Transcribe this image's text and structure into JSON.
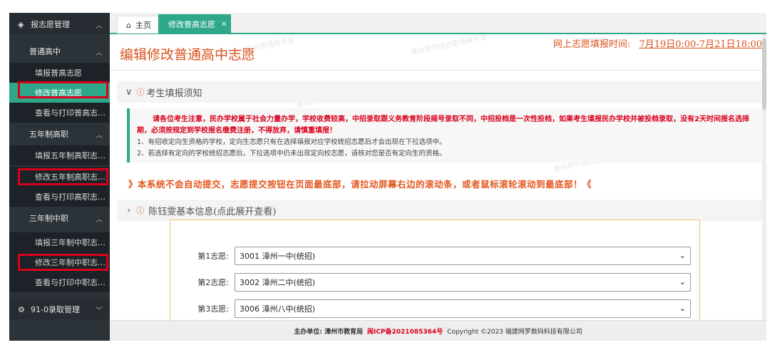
{
  "sidebar": {
    "top_menu": {
      "label": "报志愿管理",
      "icon": "layers-icon"
    },
    "groups": [
      {
        "label": "普通高中",
        "items": [
          "填报普高志愿",
          "修改普高志愿",
          "查看与打印普高志…"
        ]
      },
      {
        "label": "五年制高职",
        "items": [
          "填报五年制高职志…",
          "修改五年制高职志…",
          "查看与打印高职志…"
        ]
      },
      {
        "label": "三年制中职",
        "items": [
          "填报三年制中职志…",
          "修改三年制中职志…",
          "查看与打印中职志…"
        ]
      }
    ],
    "bottom_menu": {
      "label": "91-0录取管理",
      "icon": "gear-icon"
    }
  },
  "tabs": {
    "home": "主页",
    "active": "修改普高志愿"
  },
  "page": {
    "title": "编辑修改普通高中志愿",
    "deadline_label": "网上志愿填报时间:",
    "deadline_value": "7月19日0:00-7月21日18:00"
  },
  "notice": {
    "heading": "考生填报须知",
    "red_text": "请各位考生注意，民办学校属于社会力量办学，学校收费较高，中招录取跟义务教育阶段摇号录取不同，中招投档是一次性投档，如果考生填报民办学校并被投档录取，没有2天时间报名选择期，必须按规定到学校报名缴费注册，不得放弃，请慎重填报！",
    "line1": "1、有招收定向生资格的学校，定向生志愿只有在选择填报对应学校统招志愿后才会出现在下拉选项中。",
    "line2": "2、若选择有定向的学校统招志愿后，下拉选项中仍未出现定向校志愿，请核对您是否有定向生的资格。"
  },
  "warning": "》本系统不会自动提交，志愿提交按钮在页面最底部，请拉动屏幕右边的滚动条，或者鼠标滚轮滚动到最底部！《",
  "info_heading": "陈钰雯基本信息(点此展开查看)",
  "choices": [
    {
      "label": "第1志愿:",
      "value": "3001 漳州一中(统招)"
    },
    {
      "label": "第2志愿:",
      "value": "3002 漳州二中(统招)"
    },
    {
      "label": "第3志愿:",
      "value": "3006 漳州八中(统招)"
    }
  ],
  "footer": {
    "sponsor": "主办单位: 漳州市教育局",
    "icp": "闽ICP备2021085364号",
    "copyright": "Copyright ©2023 福建网罗数码科技有限公司"
  },
  "colors": {
    "accent": "#2fa889",
    "title": "#d9531e",
    "highlight": "#d9001b",
    "sidebar": "#2b3238"
  }
}
